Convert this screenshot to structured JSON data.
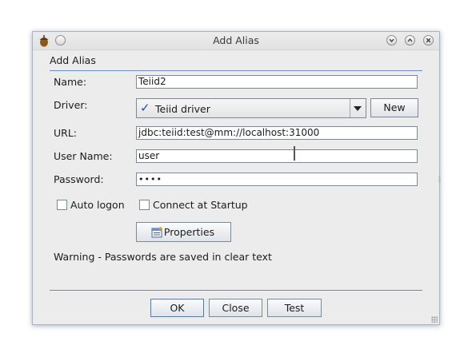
{
  "window": {
    "title": "Add Alias"
  },
  "section_title": "Add Alias",
  "form": {
    "name_label": "Name:",
    "name_value": "Teiid2",
    "driver_label": "Driver:",
    "driver_value": "Teiid driver",
    "new_button": "New",
    "url_label": "URL:",
    "url_value": "jdbc:teiid:test@mm://localhost:31000",
    "username_label": "User Name:",
    "username_value": "user",
    "password_label": "Password:",
    "password_value": "••••",
    "auto_logon_label": "Auto logon",
    "connect_startup_label": "Connect at Startup",
    "properties_button": "Properties"
  },
  "warning": "Warning - Passwords are saved in clear text",
  "buttons": {
    "ok": "OK",
    "close": "Close",
    "test": "Test"
  },
  "colors": {
    "accent_line": "#6a8ec1",
    "check_mark": "#1d4fb8",
    "window_bg": "#ececec"
  }
}
